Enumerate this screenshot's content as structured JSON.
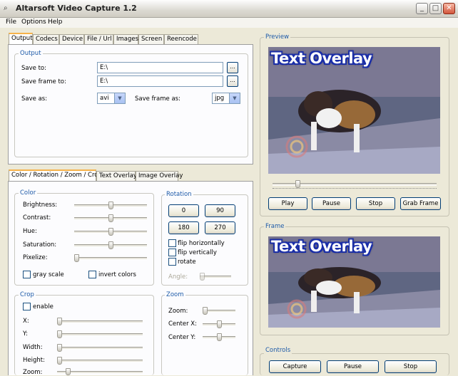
{
  "window": {
    "title": "Altarsoft Video Capture 1.2",
    "app_icon": "magnifier-icon",
    "minimize": "_",
    "maximize": "□",
    "close": "✕"
  },
  "menu": [
    "File",
    "Options",
    "Help"
  ],
  "top_tabs": [
    "Output",
    "Codecs",
    "Device",
    "File / Url",
    "Images",
    "Screen",
    "Reencode"
  ],
  "output": {
    "group_title": "Output",
    "save_to_label": "Save to:",
    "save_to_value": "E:\\",
    "save_frame_to_label": "Save frame to:",
    "save_frame_to_value": "E:\\",
    "browse_label": "...",
    "save_as_label": "Save as:",
    "save_as_value": "avi",
    "save_frame_as_label": "Save frame as:",
    "save_frame_as_value": "jpg"
  },
  "bottom_tabs": [
    "Color / Rotation / Zoom / Crop",
    "Text Overlay",
    "Image Overlay"
  ],
  "color": {
    "group_title": "Color",
    "brightness_label": "Brightness:",
    "contrast_label": "Contrast:",
    "hue_label": "Hue:",
    "saturation_label": "Saturation:",
    "pixelize_label": "Pixelize:",
    "gray_scale_label": "gray scale",
    "invert_colors_label": "invert colors",
    "levels": {
      "brightness": 0.5,
      "contrast": 0.5,
      "hue": 0.5,
      "saturation": 0.5,
      "pixelize": 0.0
    }
  },
  "rotation": {
    "group_title": "Rotation",
    "btn_0": "0",
    "btn_90": "90",
    "btn_180": "180",
    "btn_270": "270",
    "flip_h_label": "flip horizontally",
    "flip_v_label": "flip vertically",
    "rotate_label": "rotate",
    "angle_label": "Angle:"
  },
  "crop": {
    "group_title": "Crop",
    "enable_label": "enable",
    "x_label": "X:",
    "y_label": "Y:",
    "width_label": "Width:",
    "height_label": "Height:",
    "zoom_label": "Zoom:"
  },
  "zoom": {
    "group_title": "Zoom",
    "zoom_label": "Zoom:",
    "center_x_label": "Center X:",
    "center_y_label": "Center Y:"
  },
  "preview": {
    "group_title": "Preview",
    "overlay_text": "Text Overlay",
    "play_label": "Play",
    "pause_label": "Pause",
    "stop_label": "Stop",
    "grab_frame_label": "Grab Frame"
  },
  "frame": {
    "group_title": "Frame",
    "overlay_text": "Text Overlay"
  },
  "controls": {
    "group_title": "Controls",
    "capture_label": "Capture",
    "pause_label": "Pause",
    "stop_label": "Stop"
  },
  "colors": {
    "tab_accent": "#f6b24a",
    "group_title": "#1d5aa8",
    "overlay_outline": "#1a2ea8"
  }
}
